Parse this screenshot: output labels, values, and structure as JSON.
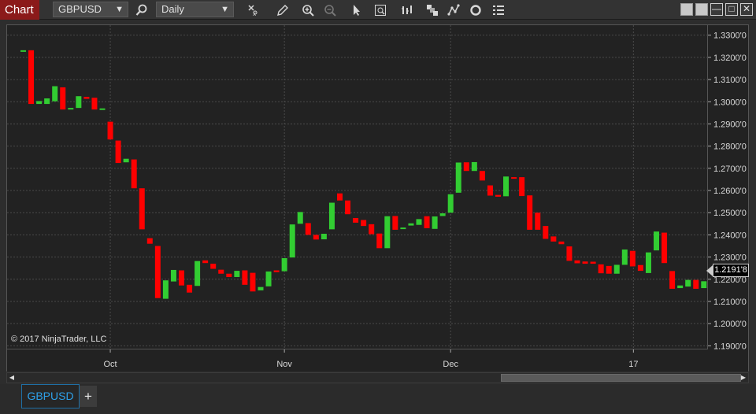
{
  "toolbar": {
    "chart_label": "Chart",
    "instrument": "GBPUSD",
    "interval": "Daily",
    "icons": [
      "search-icon",
      "data-box-icon",
      "pencil-icon",
      "zoom-in-icon",
      "zoom-out-icon",
      "pointer-icon",
      "chart-properties-icon",
      "bar-style-icon",
      "stacked-icon",
      "strategy-icon",
      "refresh-icon",
      "list-icon"
    ],
    "window_buttons": [
      "tile-icon",
      "tile-icon-2",
      "minimize-icon",
      "maximize-icon",
      "close-icon"
    ]
  },
  "copyright": "© 2017 NinjaTrader, LLC",
  "price_tag": "1.2191'8",
  "time_labels": [
    "Oct",
    "Nov",
    "Dec",
    "17"
  ],
  "price_labels": [
    "1.3300'0",
    "1.3200'0",
    "1.3100'0",
    "1.3000'0",
    "1.2900'0",
    "1.2800'0",
    "1.2700'0",
    "1.2600'0",
    "1.2500'0",
    "1.2400'0",
    "1.2300'0",
    "1.2200'0",
    "1.2100'0",
    "1.2000'0",
    "1.1900'0"
  ],
  "tabs": {
    "instrument_tab": "GBPUSD",
    "add_label": "+"
  },
  "colors": {
    "up": "#32cd32",
    "down": "#ff0000",
    "background": "#222222",
    "grid": "#4a4a4a"
  },
  "chart_data": {
    "type": "candlestick",
    "instrument": "GBPUSD",
    "interval": "Daily",
    "ylim": [
      1.188,
      1.3345
    ],
    "xlabels": [
      "Oct",
      "Nov",
      "Dec",
      "17"
    ],
    "candles": [
      [
        1.3232,
        1.3232
      ],
      [
        1.3232,
        1.299
      ],
      [
        1.299,
        1.3003
      ],
      [
        1.299,
        1.3015
      ],
      [
        1.3002,
        1.307
      ],
      [
        1.3065,
        1.2965
      ],
      [
        1.2965,
        1.2972
      ],
      [
        1.2972,
        1.3025
      ],
      [
        1.3022,
        1.3013
      ],
      [
        1.3018,
        1.2965
      ],
      [
        1.2967,
        1.297
      ],
      [
        1.291,
        1.283
      ],
      [
        1.2825,
        1.2724
      ],
      [
        1.2727,
        1.2743
      ],
      [
        1.274,
        1.261
      ],
      [
        1.261,
        1.2425
      ],
      [
        1.2385,
        1.236
      ],
      [
        1.235,
        1.2115
      ],
      [
        1.2112,
        1.2195
      ],
      [
        1.219,
        1.2242
      ],
      [
        1.224,
        1.2172
      ],
      [
        1.2175,
        1.214
      ],
      [
        1.217,
        1.2282
      ],
      [
        1.2285,
        1.2273
      ],
      [
        1.227,
        1.2247
      ],
      [
        1.2243,
        1.2225
      ],
      [
        1.2225,
        1.221
      ],
      [
        1.221,
        1.2238
      ],
      [
        1.224,
        1.2175
      ],
      [
        1.2229,
        1.2145
      ],
      [
        1.215,
        1.2165
      ],
      [
        1.2168,
        1.2235
      ],
      [
        1.224,
        1.2232
      ],
      [
        1.2236,
        1.2295
      ],
      [
        1.2298,
        1.2447
      ],
      [
        1.245,
        1.2503
      ],
      [
        1.2453,
        1.24
      ],
      [
        1.24,
        1.2379
      ],
      [
        1.238,
        1.2405
      ],
      [
        1.2425,
        1.2545
      ],
      [
        1.2587,
        1.2555
      ],
      [
        1.2555,
        1.2493
      ],
      [
        1.2476,
        1.2455
      ],
      [
        1.2467,
        1.244
      ],
      [
        1.2448,
        1.2403
      ],
      [
        1.2406,
        1.234
      ],
      [
        1.234,
        1.2484
      ],
      [
        1.2485,
        1.2423
      ],
      [
        1.2427,
        1.2433
      ],
      [
        1.2442,
        1.2452
      ],
      [
        1.2445,
        1.2471
      ],
      [
        1.2484,
        1.243
      ],
      [
        1.2427,
        1.2483
      ],
      [
        1.2485,
        1.2497
      ],
      [
        1.25,
        1.2583
      ],
      [
        1.259,
        1.2726
      ],
      [
        1.2727,
        1.2688
      ],
      [
        1.2688,
        1.2728
      ],
      [
        1.2688,
        1.2645
      ],
      [
        1.2623,
        1.2577
      ],
      [
        1.258,
        1.2572
      ],
      [
        1.2574,
        1.2663
      ],
      [
        1.266,
        1.2653
      ],
      [
        1.266,
        1.2575
      ],
      [
        1.2578,
        1.2423
      ],
      [
        1.25,
        1.2423
      ],
      [
        1.244,
        1.2382
      ],
      [
        1.2393,
        1.237
      ],
      [
        1.237,
        1.2358
      ],
      [
        1.2348,
        1.2283
      ],
      [
        1.2285,
        1.2272
      ],
      [
        1.228,
        1.227
      ],
      [
        1.2279,
        1.227
      ],
      [
        1.2267,
        1.2227
      ],
      [
        1.226,
        1.2225
      ],
      [
        1.2225,
        1.2265
      ],
      [
        1.2265,
        1.2334
      ],
      [
        1.2328,
        1.2258
      ],
      [
        1.2264,
        1.2238
      ],
      [
        1.2228,
        1.2321
      ],
      [
        1.233,
        1.2415
      ],
      [
        1.241,
        1.2273
      ],
      [
        1.2237,
        1.2157
      ],
      [
        1.216,
        1.2172
      ],
      [
        1.2167,
        1.2197
      ],
      [
        1.2197,
        1.2157
      ],
      [
        1.216,
        1.2191
      ]
    ]
  }
}
